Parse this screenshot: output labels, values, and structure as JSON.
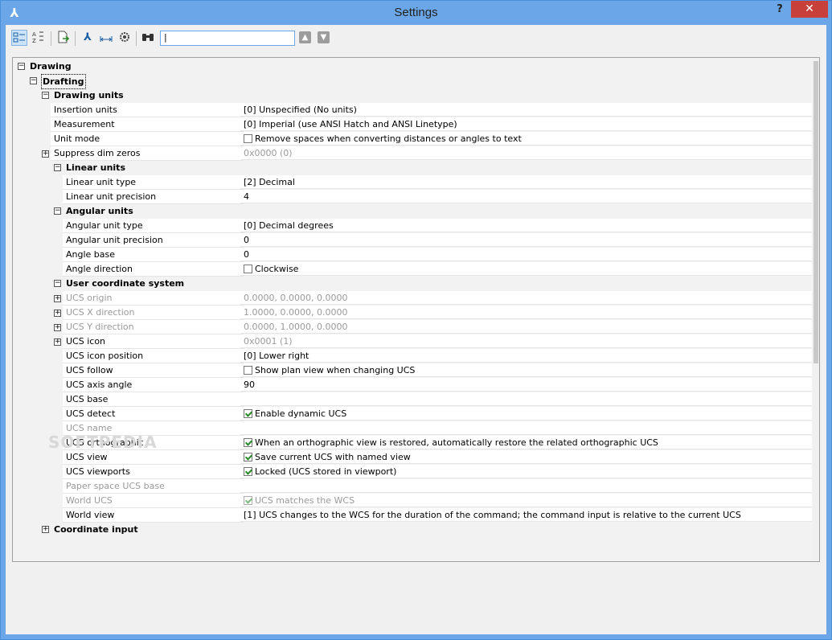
{
  "window": {
    "title": "Settings",
    "help_label": "?",
    "close_label": "✕"
  },
  "toolbar": {
    "search_value": "|",
    "buttons": [
      "categorized-view",
      "alphabetical-view",
      "export",
      "program-settings",
      "dimension-styles",
      "drawing-settings",
      "find"
    ]
  },
  "tree": {
    "drawing": "Drawing",
    "drafting": "Drafting",
    "drawing_units": "Drawing units",
    "linear_units": "Linear units",
    "angular_units": "Angular units",
    "ucs": "User coordinate system",
    "coordinate_input": "Coordinate input"
  },
  "rows": {
    "insertion_units": {
      "name": "Insertion units",
      "value": "[0] Unspecified (No units)"
    },
    "measurement": {
      "name": "Measurement",
      "value": "[0] Imperial (use ANSI Hatch and ANSI Linetype)"
    },
    "unit_mode": {
      "name": "Unit mode",
      "value": "Remove spaces when converting distances or angles to text",
      "checked": false
    },
    "suppress_dim_zeros": {
      "name": "Suppress dim zeros",
      "value": "0x0000 (0)"
    },
    "linear_unit_type": {
      "name": "Linear unit type",
      "value": "[2] Decimal"
    },
    "linear_unit_precision": {
      "name": "Linear unit precision",
      "value": "4"
    },
    "angular_unit_type": {
      "name": "Angular unit type",
      "value": "[0] Decimal degrees"
    },
    "angular_unit_precision": {
      "name": "Angular unit precision",
      "value": "0"
    },
    "angle_base": {
      "name": "Angle base",
      "value": "0"
    },
    "angle_direction": {
      "name": "Angle direction",
      "value": "Clockwise",
      "checked": false
    },
    "ucs_origin": {
      "name": "UCS origin",
      "value": "0.0000, 0.0000, 0.0000"
    },
    "ucs_x_direction": {
      "name": "UCS X direction",
      "value": "1.0000, 0.0000, 0.0000"
    },
    "ucs_y_direction": {
      "name": "UCS Y direction",
      "value": "0.0000, 1.0000, 0.0000"
    },
    "ucs_icon": {
      "name": "UCS icon",
      "value": "0x0001 (1)"
    },
    "ucs_icon_position": {
      "name": "UCS icon position",
      "value": "[0] Lower right"
    },
    "ucs_follow": {
      "name": "UCS follow",
      "value": "Show plan view when changing UCS",
      "checked": false
    },
    "ucs_axis_angle": {
      "name": "UCS axis angle",
      "value": "90"
    },
    "ucs_base": {
      "name": "UCS base",
      "value": ""
    },
    "ucs_detect": {
      "name": "UCS detect",
      "value": "Enable dynamic UCS",
      "checked": true
    },
    "ucs_name": {
      "name": "UCS name",
      "value": ""
    },
    "ucs_orthographic": {
      "name": "UCS orthographic",
      "value": "When an orthographic view is restored, automatically restore the related orthographic UCS",
      "checked": true
    },
    "ucs_view": {
      "name": "UCS view",
      "value": "Save current UCS with named view",
      "checked": true
    },
    "ucs_viewports": {
      "name": "UCS viewports",
      "value": "Locked (UCS stored in viewport)",
      "checked": true
    },
    "paper_space_ucs_base": {
      "name": "Paper space UCS base",
      "value": ""
    },
    "world_ucs": {
      "name": "World UCS",
      "value": "UCS matches the WCS",
      "checked": true
    },
    "world_view": {
      "name": "World view",
      "value": "[1] UCS changes to the WCS for the duration of the command; the command input is relative to the current UCS"
    }
  },
  "watermark": "SOFTPEDIA"
}
